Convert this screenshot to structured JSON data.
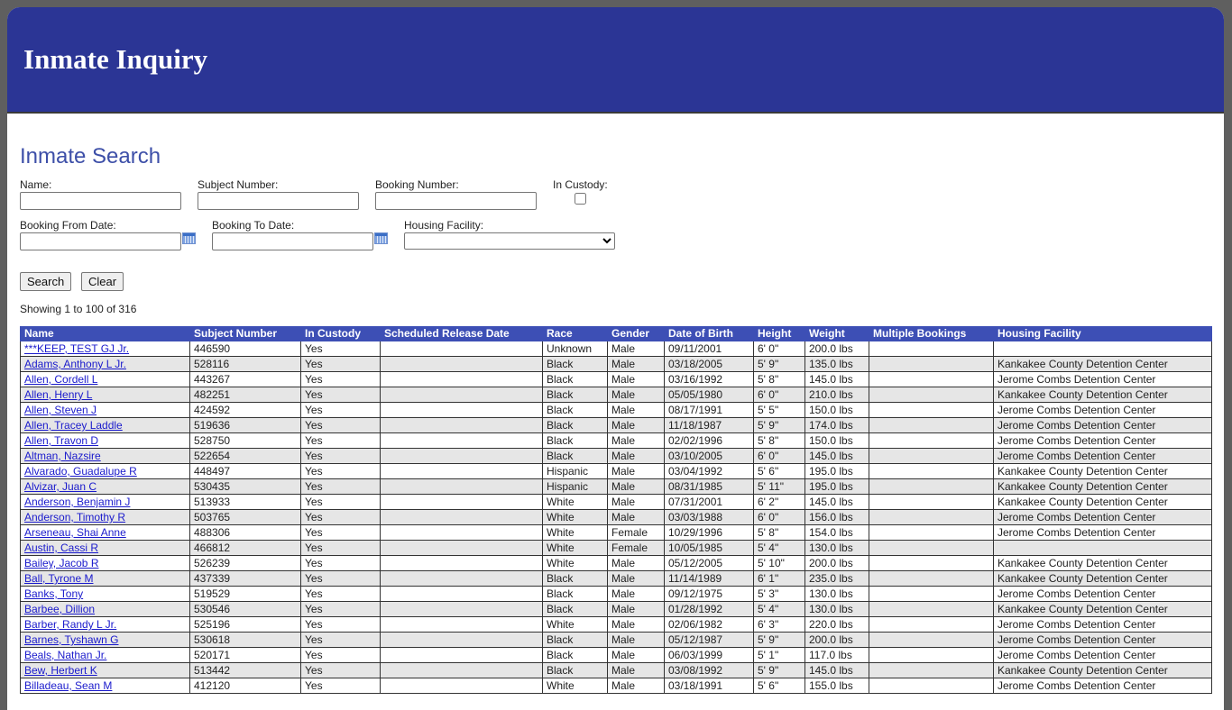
{
  "header": {
    "title": "Inmate Inquiry"
  },
  "search": {
    "title": "Inmate Search",
    "name_label": "Name:",
    "name_value": "",
    "subject_label": "Subject Number:",
    "subject_value": "",
    "booking_label": "Booking Number:",
    "booking_value": "",
    "custody_label": "In Custody:",
    "custody_checked": false,
    "from_label": "Booking From Date:",
    "from_value": "",
    "to_label": "Booking To Date:",
    "to_value": "",
    "facility_label": "Housing Facility:",
    "facility_selected": "",
    "search_button": "Search",
    "clear_button": "Clear"
  },
  "results": {
    "summary": "Showing 1 to 100 of 316",
    "columns": [
      "Name",
      "Subject Number",
      "In Custody",
      "Scheduled Release Date",
      "Race",
      "Gender",
      "Date of Birth",
      "Height",
      "Weight",
      "Multiple Bookings",
      "Housing Facility"
    ],
    "rows": [
      [
        "***KEEP, TEST GJ Jr.",
        "446590",
        "Yes",
        "",
        "Unknown",
        "Male",
        "09/11/2001",
        "6' 0\"",
        "200.0 lbs",
        "",
        ""
      ],
      [
        "Adams, Anthony L Jr.",
        "528116",
        "Yes",
        "",
        "Black",
        "Male",
        "03/18/2005",
        "5' 9\"",
        "135.0 lbs",
        "",
        "Kankakee County Detention Center"
      ],
      [
        "Allen, Cordell L",
        "443267",
        "Yes",
        "",
        "Black",
        "Male",
        "03/16/1992",
        "5' 8\"",
        "145.0 lbs",
        "",
        "Jerome Combs Detention Center"
      ],
      [
        "Allen, Henry L",
        "482251",
        "Yes",
        "",
        "Black",
        "Male",
        "05/05/1980",
        "6' 0\"",
        "210.0 lbs",
        "",
        "Kankakee County Detention Center"
      ],
      [
        "Allen, Steven J",
        "424592",
        "Yes",
        "",
        "Black",
        "Male",
        "08/17/1991",
        "5' 5\"",
        "150.0 lbs",
        "",
        "Jerome Combs Detention Center"
      ],
      [
        "Allen, Tracey Laddle",
        "519636",
        "Yes",
        "",
        "Black",
        "Male",
        "11/18/1987",
        "5' 9\"",
        "174.0 lbs",
        "",
        "Jerome Combs Detention Center"
      ],
      [
        "Allen, Travon D",
        "528750",
        "Yes",
        "",
        "Black",
        "Male",
        "02/02/1996",
        "5' 8\"",
        "150.0 lbs",
        "",
        "Jerome Combs Detention Center"
      ],
      [
        "Altman, Nazsire",
        "522654",
        "Yes",
        "",
        "Black",
        "Male",
        "03/10/2005",
        "6' 0\"",
        "145.0 lbs",
        "",
        "Jerome Combs Detention Center"
      ],
      [
        "Alvarado, Guadalupe R",
        "448497",
        "Yes",
        "",
        "Hispanic",
        "Male",
        "03/04/1992",
        "5' 6\"",
        "195.0 lbs",
        "",
        "Kankakee County Detention Center"
      ],
      [
        "Alvizar, Juan C",
        "530435",
        "Yes",
        "",
        "Hispanic",
        "Male",
        "08/31/1985",
        "5' 11\"",
        "195.0 lbs",
        "",
        "Kankakee County Detention Center"
      ],
      [
        "Anderson, Benjamin J",
        "513933",
        "Yes",
        "",
        "White",
        "Male",
        "07/31/2001",
        "6' 2\"",
        "145.0 lbs",
        "",
        "Kankakee County Detention Center"
      ],
      [
        "Anderson, Timothy R",
        "503765",
        "Yes",
        "",
        "White",
        "Male",
        "03/03/1988",
        "6' 0\"",
        "156.0 lbs",
        "",
        "Jerome Combs Detention Center"
      ],
      [
        "Arseneau, Shai Anne",
        "488306",
        "Yes",
        "",
        "White",
        "Female",
        "10/29/1996",
        "5' 8\"",
        "154.0 lbs",
        "",
        "Jerome Combs Detention Center"
      ],
      [
        "Austin, Cassi R",
        "466812",
        "Yes",
        "",
        "White",
        "Female",
        "10/05/1985",
        "5' 4\"",
        "130.0 lbs",
        "",
        ""
      ],
      [
        "Bailey, Jacob R",
        "526239",
        "Yes",
        "",
        "White",
        "Male",
        "05/12/2005",
        "5' 10\"",
        "200.0 lbs",
        "",
        "Kankakee County Detention Center"
      ],
      [
        "Ball, Tyrone M",
        "437339",
        "Yes",
        "",
        "Black",
        "Male",
        "11/14/1989",
        "6' 1\"",
        "235.0 lbs",
        "",
        "Kankakee County Detention Center"
      ],
      [
        "Banks, Tony",
        "519529",
        "Yes",
        "",
        "Black",
        "Male",
        "09/12/1975",
        "5' 3\"",
        "130.0 lbs",
        "",
        "Jerome Combs Detention Center"
      ],
      [
        "Barbee, Dillion",
        "530546",
        "Yes",
        "",
        "Black",
        "Male",
        "01/28/1992",
        "5' 4\"",
        "130.0 lbs",
        "",
        "Kankakee County Detention Center"
      ],
      [
        "Barber, Randy L Jr.",
        "525196",
        "Yes",
        "",
        "White",
        "Male",
        "02/06/1982",
        "6' 3\"",
        "220.0 lbs",
        "",
        "Jerome Combs Detention Center"
      ],
      [
        "Barnes, Tyshawn G",
        "530618",
        "Yes",
        "",
        "Black",
        "Male",
        "05/12/1987",
        "5' 9\"",
        "200.0 lbs",
        "",
        "Jerome Combs Detention Center"
      ],
      [
        "Beals, Nathan Jr.",
        "520171",
        "Yes",
        "",
        "Black",
        "Male",
        "06/03/1999",
        "5' 1\"",
        "117.0 lbs",
        "",
        "Jerome Combs Detention Center"
      ],
      [
        "Bew, Herbert K",
        "513442",
        "Yes",
        "",
        "Black",
        "Male",
        "03/08/1992",
        "5' 9\"",
        "145.0 lbs",
        "",
        "Kankakee County Detention Center"
      ],
      [
        "Billadeau, Sean M",
        "412120",
        "Yes",
        "",
        "White",
        "Male",
        "03/18/1991",
        "5' 6\"",
        "155.0 lbs",
        "",
        "Jerome Combs Detention Center"
      ]
    ]
  }
}
